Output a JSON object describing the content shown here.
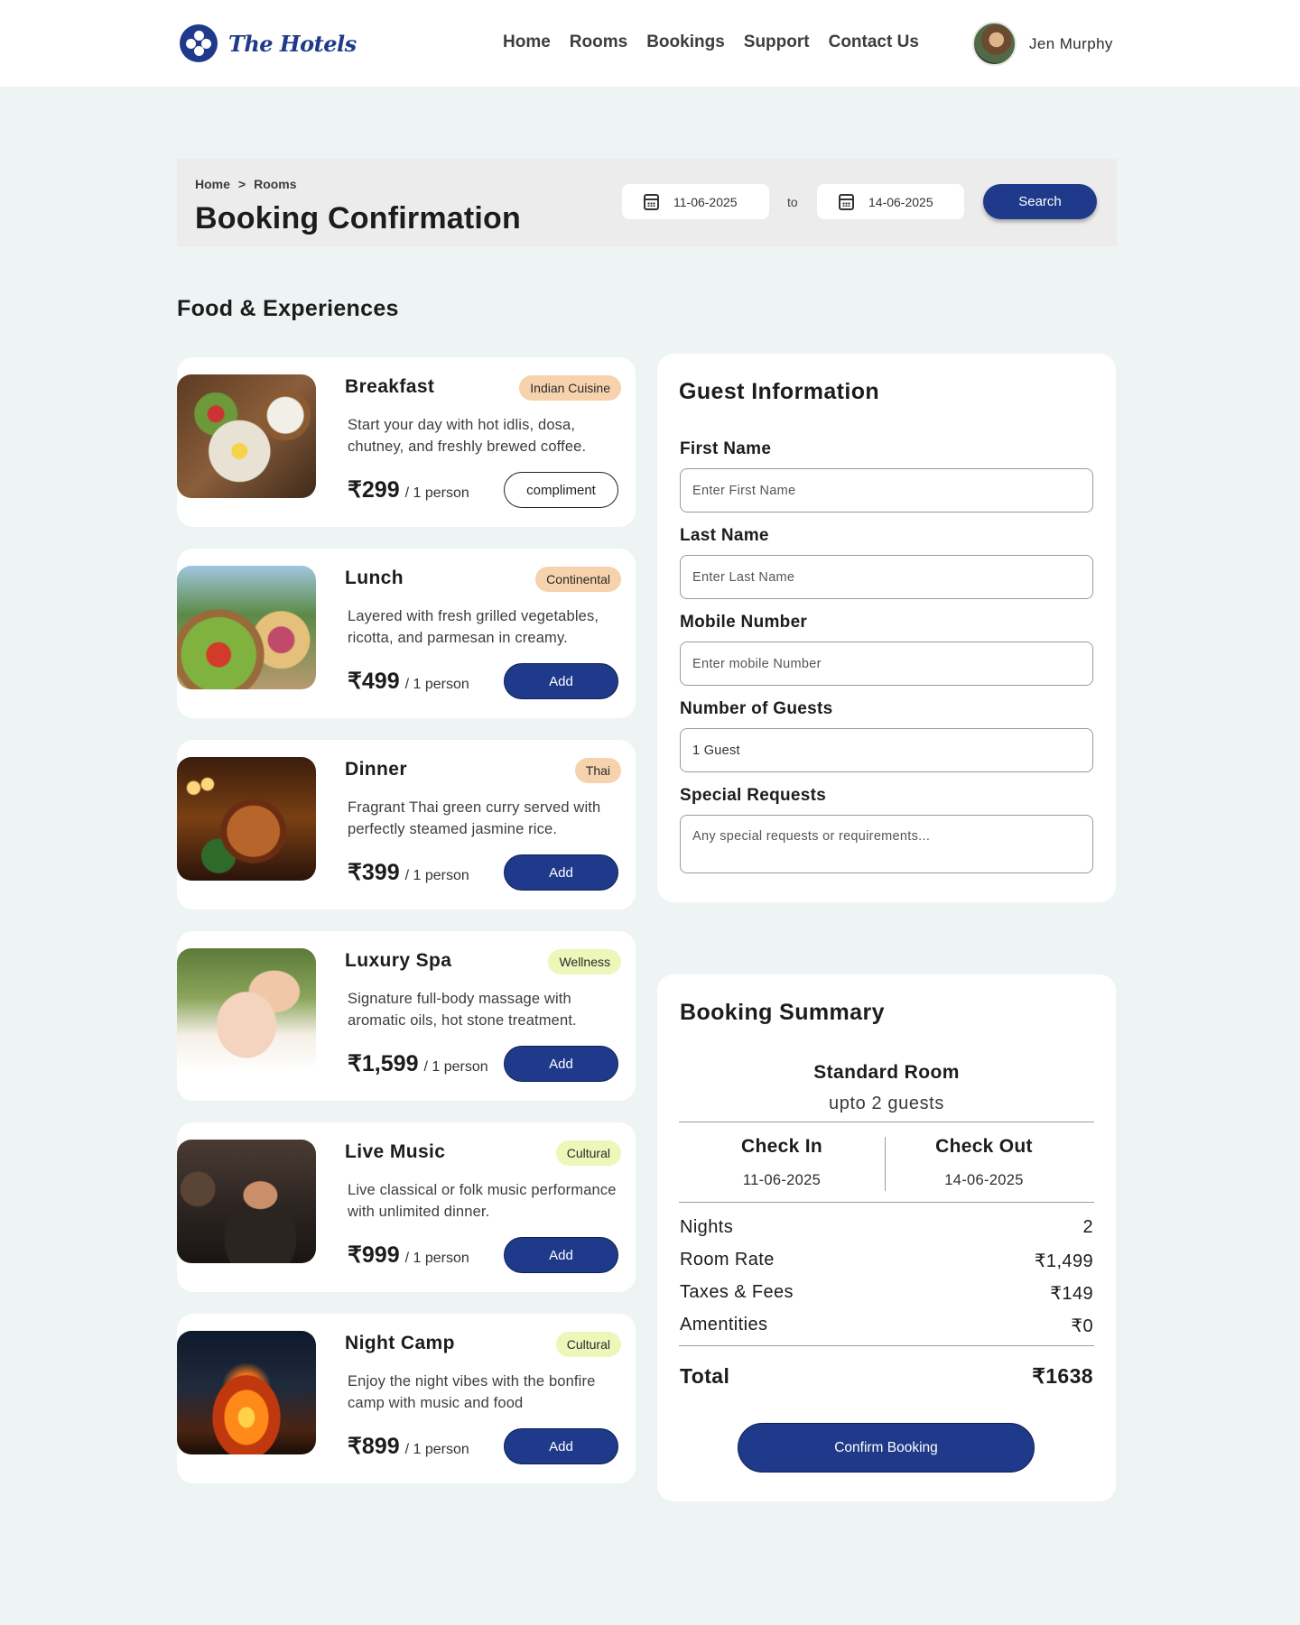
{
  "brand": {
    "name": "The Hotels"
  },
  "nav": [
    "Home",
    "Rooms",
    "Bookings",
    "Support",
    "Contact Us"
  ],
  "user": {
    "name": "Jen Murphy"
  },
  "breadcrumb": [
    "Home",
    ">",
    "Rooms"
  ],
  "page_title": "Booking Confirmation",
  "search": {
    "from": "11-06-2025",
    "to_label": "to",
    "to": "14-06-2025",
    "button": "Search"
  },
  "section_title": "Food & Experiences",
  "experiences": [
    {
      "name": "Breakfast",
      "tag": "Indian Cuisine",
      "desc": "Start your day with hot idlis, dosa, chutney, and freshly brewed coffee.",
      "price": "₹299",
      "per": "/ 1 person",
      "action": "compliment"
    },
    {
      "name": "Lunch",
      "tag": "Continental",
      "desc": "Layered with fresh grilled vegetables, ricotta, and parmesan in creamy.",
      "price": "₹499",
      "per": "/ 1 person",
      "action": "Add"
    },
    {
      "name": "Dinner",
      "tag": "Thai",
      "desc": "Fragrant Thai green curry served with perfectly steamed jasmine rice.",
      "price": "₹399",
      "per": "/ 1 person",
      "action": "Add"
    },
    {
      "name": "Luxury Spa",
      "tag": "Wellness",
      "desc": "Signature full-body massage with aromatic oils, hot stone treatment.",
      "price": "₹1,599",
      "per": "/ 1 person",
      "action": "Add"
    },
    {
      "name": "Live Music",
      "tag": "Cultural",
      "desc": "Live classical or folk music performance with unlimited dinner.",
      "price": "₹999",
      "per": "/ 1 person",
      "action": "Add"
    },
    {
      "name": "Night Camp",
      "tag": "Cultural",
      "desc": "Enjoy the night vibes with the bonfire camp with music and food",
      "price": "₹899",
      "per": "/ 1 person",
      "action": "Add"
    }
  ],
  "guest": {
    "title": "Guest Information",
    "first_label": "First Name",
    "first_placeholder": "Enter First Name",
    "last_label": "Last Name",
    "last_placeholder": "Enter Last Name",
    "mobile_label": "Mobile Number",
    "mobile_placeholder": "Enter mobile Number",
    "guests_label": "Number of Guests",
    "guests_value": "1 Guest",
    "requests_label": "Special Requests",
    "requests_placeholder": "Any special requests or requirements..."
  },
  "summary": {
    "title": "Booking Summary",
    "room": "Standard Room",
    "capacity": "upto 2 guests",
    "checkin_label": "Check In",
    "checkin": "11-06-2025",
    "checkout_label": "Check Out",
    "checkout": "14-06-2025",
    "rows": [
      {
        "label": "Nights",
        "value": "2"
      },
      {
        "label": "Room Rate",
        "value": "₹1,499"
      },
      {
        "label": "Taxes & Fees",
        "value": "₹149"
      },
      {
        "label": "Amentities",
        "value": "₹0"
      }
    ],
    "total_label": "Total",
    "total": "₹1638",
    "confirm": "Confirm Booking"
  }
}
